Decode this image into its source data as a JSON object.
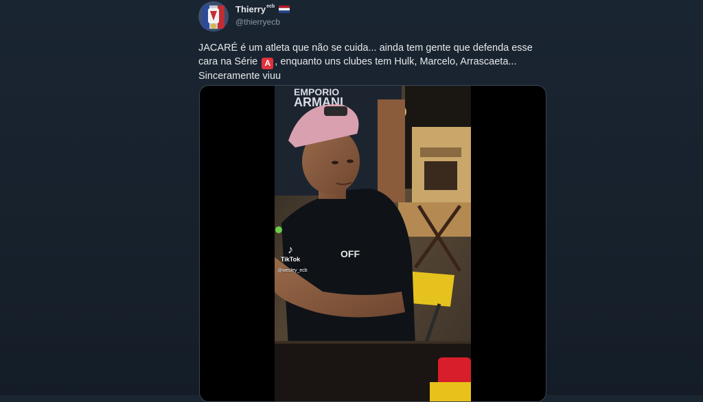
{
  "tweet": {
    "author_name": "Thierry",
    "author_name_suffix": "ecb",
    "handle": "@thierryecb",
    "text_part1": "JACARÉ é um atleta que não se cuida... ainda tem gente que defenda esse cara na Série",
    "badge": "A",
    "text_part2": ", enquanto uns clubes tem Hulk, Marcelo, Arrascaeta... Sinceramente viuu"
  },
  "video": {
    "shirt_text_line1": "EMPORIO",
    "shirt_text_line2": "ARMANI",
    "shirt_front_text": "OFF",
    "watermark_brand": "TikTok",
    "watermark_user": "@wesley_ecb"
  },
  "colors": {
    "background": "#15202b",
    "text": "#e7e9ea",
    "secondary_text": "#8b98a5",
    "badge_red": "#e0323c",
    "media_border": "#3b4754"
  },
  "icons": {
    "flag": "netherlands-flag-icon",
    "badge": "letter-a-badge-icon",
    "tiktok": "tiktok-logo-icon"
  }
}
